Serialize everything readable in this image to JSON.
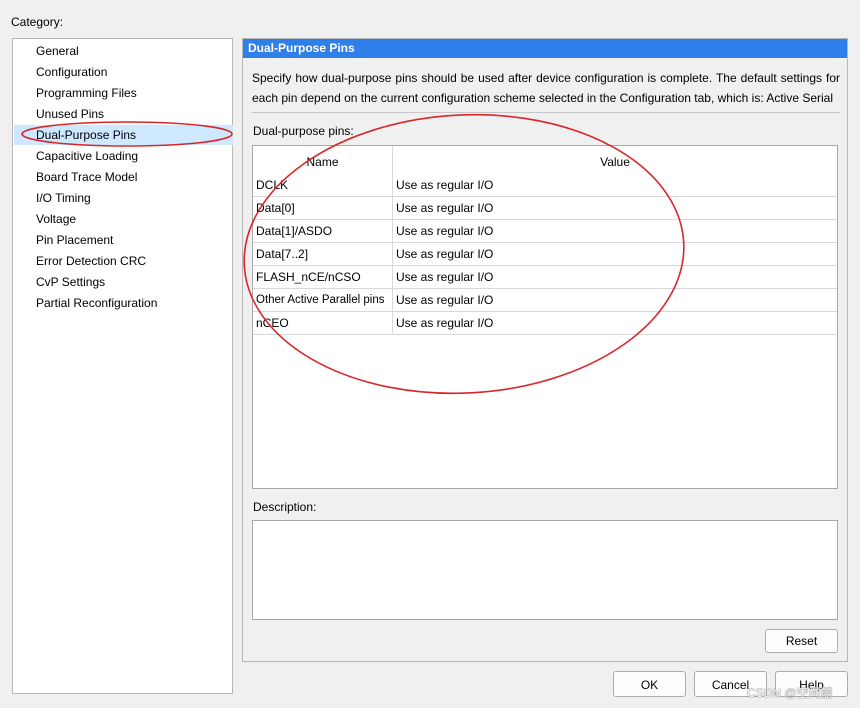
{
  "category": {
    "label": "Category:",
    "items": [
      {
        "label": "General",
        "selected": false
      },
      {
        "label": "Configuration",
        "selected": false
      },
      {
        "label": "Programming Files",
        "selected": false
      },
      {
        "label": "Unused Pins",
        "selected": false
      },
      {
        "label": "Dual-Purpose Pins",
        "selected": true
      },
      {
        "label": "Capacitive Loading",
        "selected": false
      },
      {
        "label": "Board Trace Model",
        "selected": false
      },
      {
        "label": "I/O Timing",
        "selected": false
      },
      {
        "label": "Voltage",
        "selected": false
      },
      {
        "label": "Pin Placement",
        "selected": false
      },
      {
        "label": "Error Detection CRC",
        "selected": false
      },
      {
        "label": "CvP Settings",
        "selected": false
      },
      {
        "label": "Partial Reconfiguration",
        "selected": false
      }
    ]
  },
  "panel": {
    "title": "Dual-Purpose Pins",
    "description": "Specify how dual-purpose pins should be used after device configuration is complete. The default settings for each pin depend on the current configuration scheme selected in the Configuration tab, which is:  Active Serial",
    "pins_label": "Dual-purpose pins:",
    "table": {
      "headers": [
        "Name",
        "Value"
      ],
      "rows": [
        {
          "name": "DCLK",
          "value": "Use as regular I/O"
        },
        {
          "name": "Data[0]",
          "value": "Use as regular I/O"
        },
        {
          "name": "Data[1]/ASDO",
          "value": "Use as regular I/O"
        },
        {
          "name": "Data[7..2]",
          "value": "Use as regular I/O"
        },
        {
          "name": "FLASH_nCE/nCSO",
          "value": "Use as regular I/O"
        },
        {
          "name": "Other Active Parallel pins",
          "value": "Use as regular I/O"
        },
        {
          "name": "nCEO",
          "value": "Use as regular I/O"
        }
      ]
    },
    "description_label": "Description:",
    "reset_label": "Reset"
  },
  "buttons": {
    "ok": "OK",
    "cancel": "Cancel",
    "help": "Help"
  },
  "watermark": "CSDN @空间囍",
  "colors": {
    "header_bg": "#2f7fe8",
    "selection_bg": "#cde8ff",
    "annotation": "#d9262b"
  }
}
